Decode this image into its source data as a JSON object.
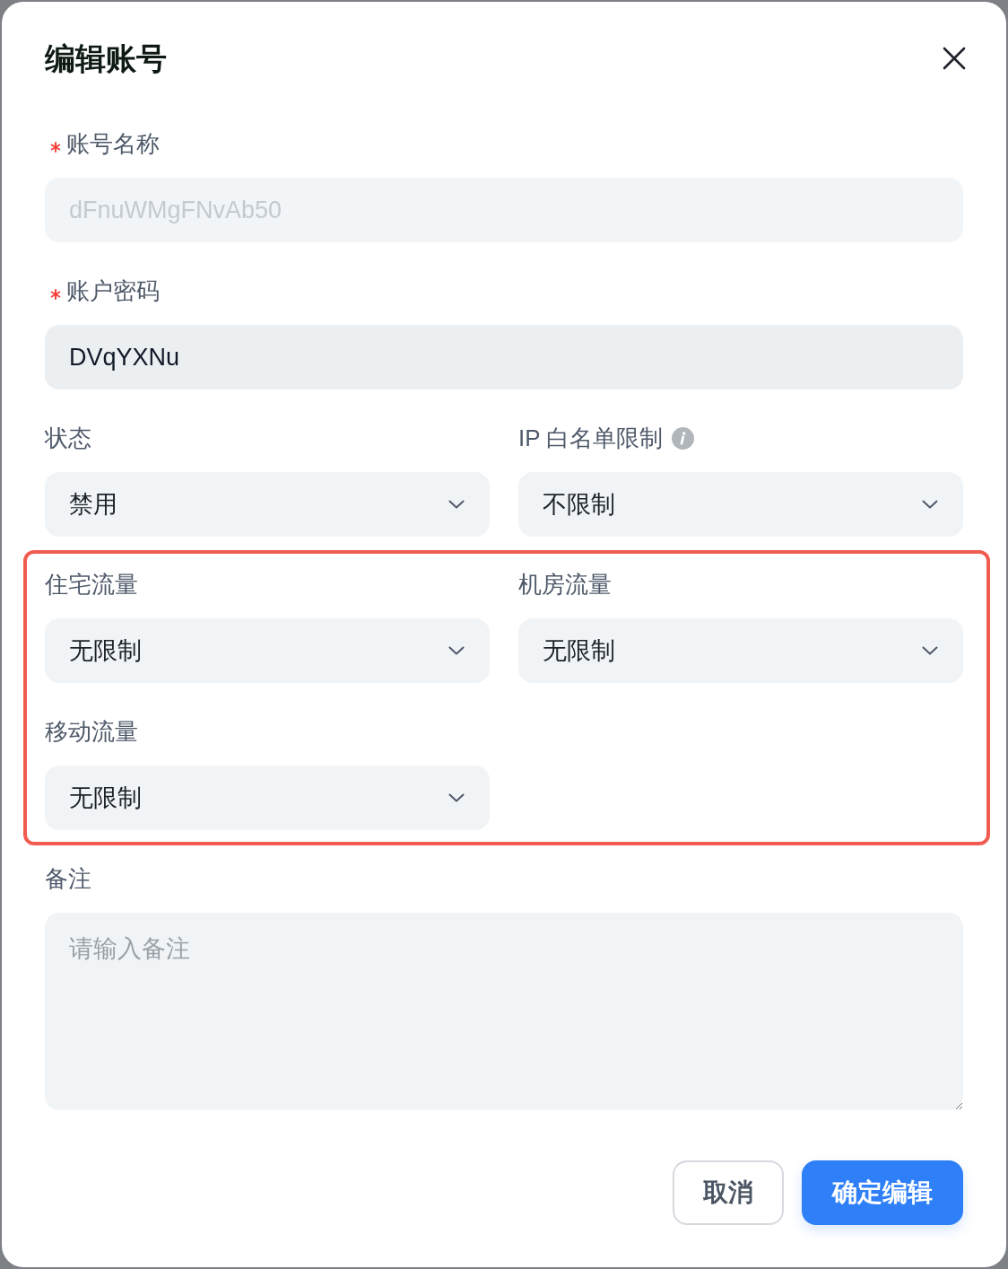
{
  "dialog": {
    "title": "编辑账号"
  },
  "fields": [
    {
      "kind": "text",
      "label": "账号名称",
      "required": true,
      "value": "dFnuWMgFNvAb50",
      "disabled": true
    },
    {
      "kind": "text",
      "label": "账户密码",
      "required": true,
      "value": "DVqYXNu",
      "disabled": false
    }
  ],
  "selects_row": [
    {
      "label": "状态",
      "value": "禁用",
      "info": false
    },
    {
      "label": "IP 白名单限制",
      "value": "不限制",
      "info": true
    }
  ],
  "traffic_group": {
    "highlighted": true,
    "selects": [
      {
        "label": "住宅流量",
        "value": "无限制"
      },
      {
        "label": "机房流量",
        "value": "无限制"
      },
      {
        "label": "移动流量",
        "value": "无限制"
      }
    ]
  },
  "notes": {
    "label": "备注",
    "placeholder": "请输入备注"
  },
  "buttons": [
    {
      "label": "取消",
      "kind": "secondary"
    },
    {
      "label": "确定编辑",
      "kind": "primary"
    }
  ]
}
